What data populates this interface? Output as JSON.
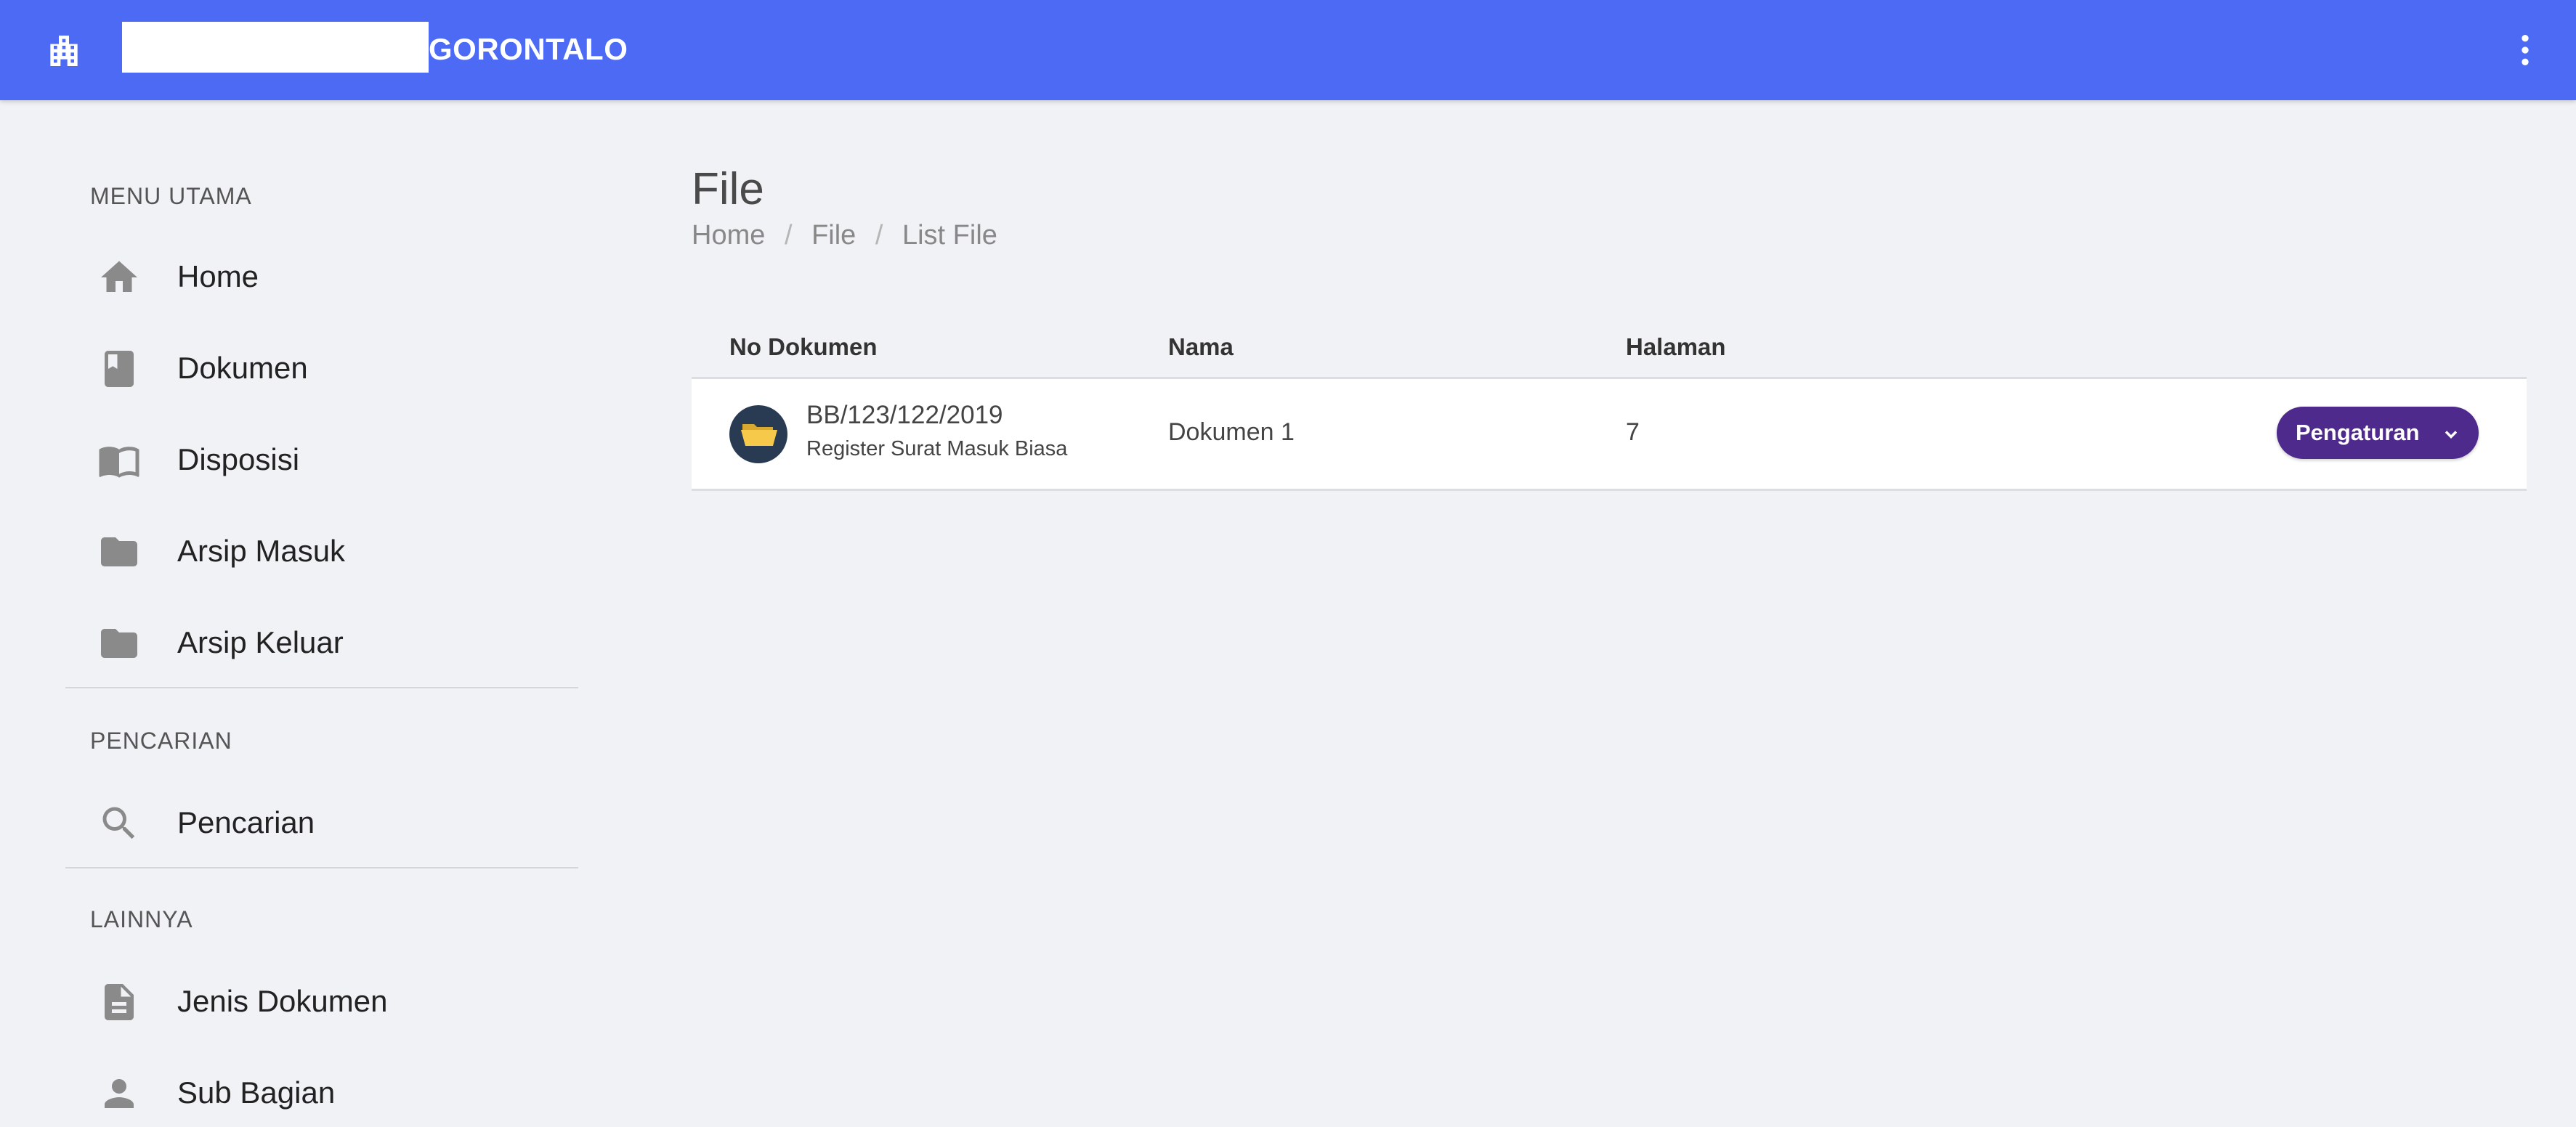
{
  "header": {
    "title": "GORONTALO",
    "brand_icon": "building-icon",
    "menu_icon": "more-vertical-icon",
    "accent": "#4d6af5"
  },
  "sidebar": {
    "sections": [
      {
        "label": "MENU UTAMA",
        "items": [
          {
            "label": "Home",
            "icon": "home-icon"
          },
          {
            "label": "Dokumen",
            "icon": "book-icon"
          },
          {
            "label": "Disposisi",
            "icon": "open-book-icon"
          },
          {
            "label": "Arsip Masuk",
            "icon": "folder-icon"
          },
          {
            "label": "Arsip Keluar",
            "icon": "folder-icon"
          }
        ]
      },
      {
        "label": "PENCARIAN",
        "items": [
          {
            "label": "Pencarian",
            "icon": "search-icon"
          }
        ]
      },
      {
        "label": "LAINNYA",
        "items": [
          {
            "label": "Jenis Dokumen",
            "icon": "document-icon"
          },
          {
            "label": "Sub Bagian",
            "icon": "person-icon"
          }
        ]
      }
    ]
  },
  "page": {
    "title": "File",
    "breadcrumb": [
      "Home",
      "File",
      "List File"
    ],
    "breadcrumb_separator": "/"
  },
  "table": {
    "columns": [
      "No Dokumen",
      "Nama",
      "Halaman"
    ],
    "rows": [
      {
        "icon": "open-folder-icon",
        "no_dokumen": "BB/123/122/2019",
        "subtitle": "Register Surat Masuk Biasa",
        "nama": "Dokumen 1",
        "halaman": "7",
        "action_label": "Pengaturan"
      }
    ]
  },
  "colors": {
    "button": "#4d2a8c",
    "page_bg": "#f1f2f6",
    "icon_grey": "#8a8a8a"
  }
}
